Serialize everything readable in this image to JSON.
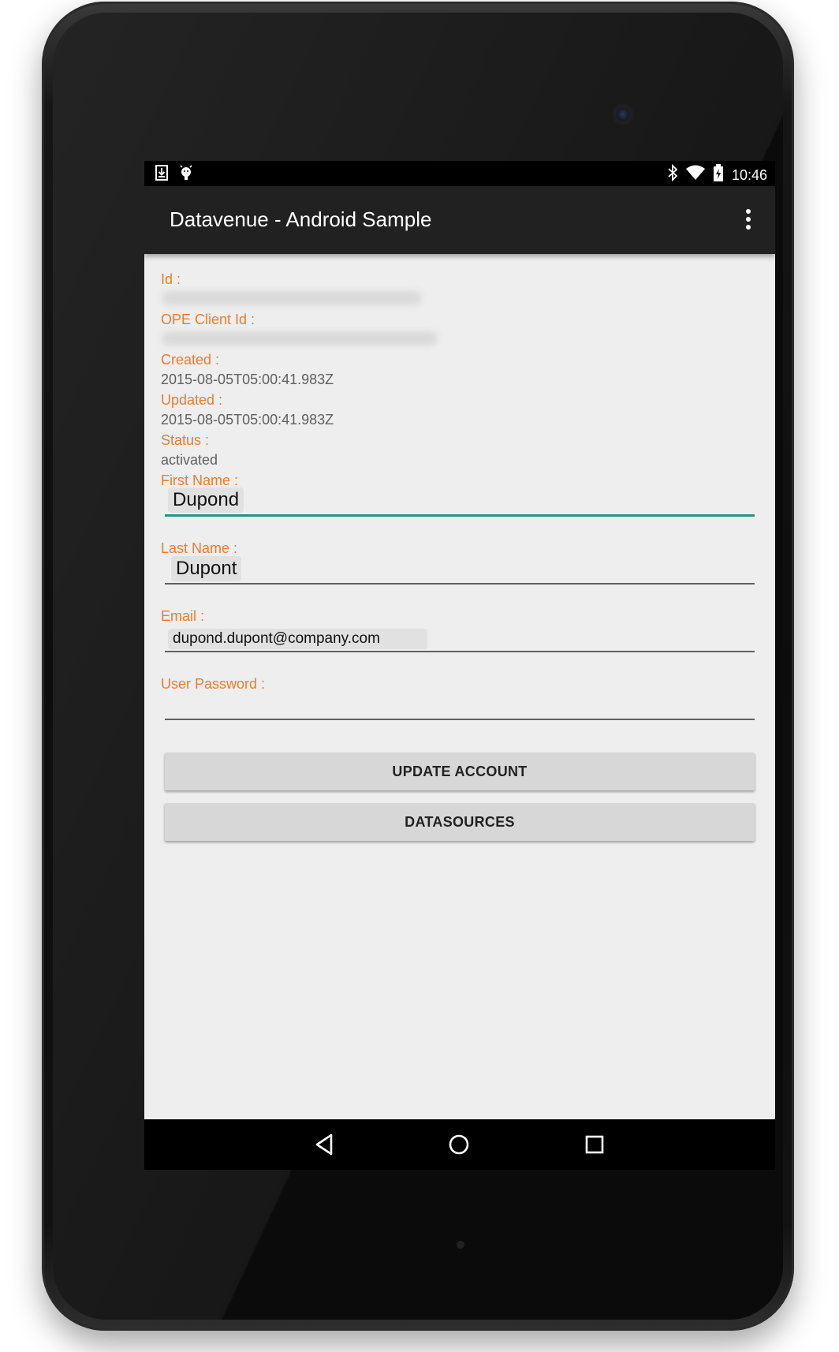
{
  "status_bar": {
    "time": "10:46",
    "icons": [
      "download-icon",
      "android-debug-icon",
      "bluetooth-icon",
      "wifi-icon",
      "battery-charging-icon"
    ]
  },
  "action_bar": {
    "title": "Datavenue - Android Sample",
    "menu_icon": "overflow-menu-icon"
  },
  "account": {
    "id_label": "Id :",
    "client_id_label": "OPE Client Id :",
    "created_label": "Created :",
    "created_value": "2015-08-05T05:00:41.983Z",
    "updated_label": "Updated :",
    "updated_value": "2015-08-05T05:00:41.983Z",
    "status_label": "Status :",
    "status_value": "activated",
    "first_name_label": "First Name :",
    "first_name_value": "Dupond",
    "last_name_label": "Last Name :",
    "last_name_value": "Dupont",
    "email_label": "Email :",
    "email_value": "dupond.dupont@company.com",
    "password_label": "User Password :",
    "password_value": ""
  },
  "buttons": {
    "update": "UPDATE ACCOUNT",
    "datasources": "DATASOURCES"
  },
  "nav_bar": {
    "icons": [
      "back-icon",
      "home-icon",
      "recents-icon"
    ]
  },
  "colors": {
    "label": "#ef7c2a",
    "action_bar": "#212121",
    "focus_accent": "#1f9488"
  }
}
